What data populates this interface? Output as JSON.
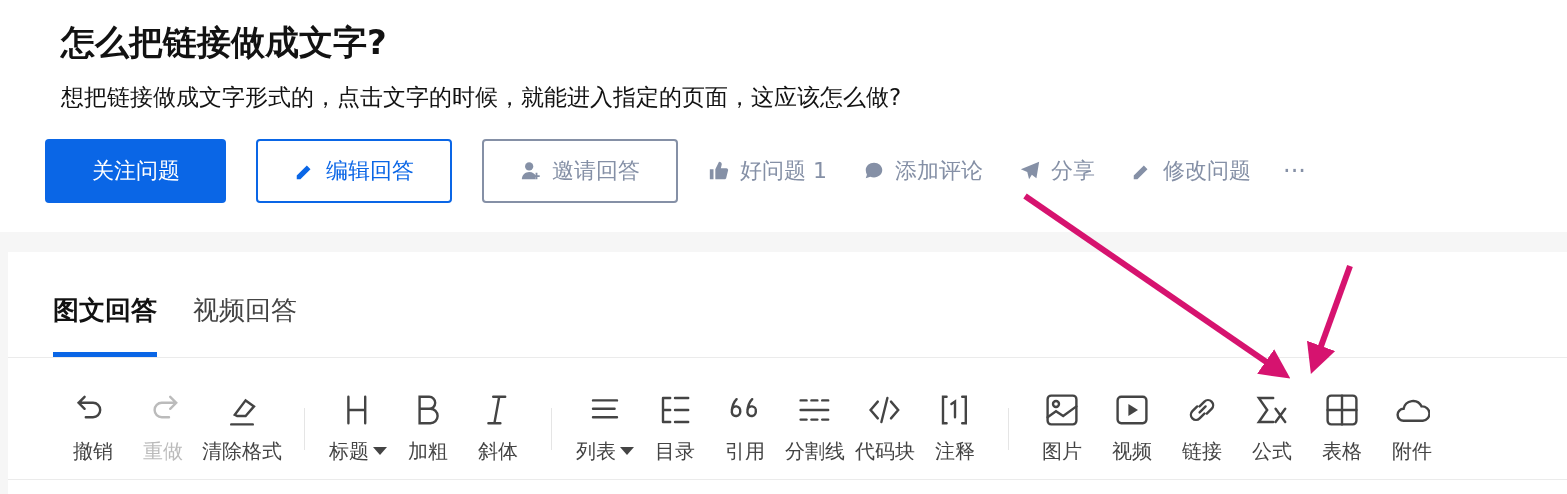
{
  "question": {
    "title": "怎么把链接做成文字?",
    "detail": "想把链接做成文字形式的，点击文字的时候，就能进入指定的页面，这应该怎么做?"
  },
  "actions": [
    {
      "kind": "primary",
      "label": "关注问题"
    },
    {
      "kind": "edit",
      "label": "编辑回答"
    },
    {
      "kind": "invite",
      "label": "邀请回答"
    },
    {
      "kind": "upvote",
      "label": "好问题 1"
    },
    {
      "kind": "comment",
      "label": "添加评论"
    },
    {
      "kind": "share",
      "label": "分享"
    },
    {
      "kind": "modify",
      "label": "修改问题"
    },
    {
      "kind": "more",
      "label": "···"
    }
  ],
  "tabs": [
    {
      "label": "图文回答",
      "selected": true
    },
    {
      "label": "视频回答",
      "selected": false
    }
  ],
  "toolbar": [
    [
      {
        "kind": "undo",
        "label": "撤销",
        "disabled": false
      },
      {
        "kind": "redo",
        "label": "重做",
        "disabled": true
      },
      {
        "kind": "eraser",
        "label": "清除格式",
        "disabled": false
      }
    ],
    [
      {
        "kind": "heading",
        "label": "标题",
        "dropdown": true,
        "disabled": false
      },
      {
        "kind": "bold",
        "label": "加粗",
        "disabled": false
      },
      {
        "kind": "italic",
        "label": "斜体",
        "disabled": false
      }
    ],
    [
      {
        "kind": "list",
        "label": "列表",
        "dropdown": true,
        "disabled": false
      },
      {
        "kind": "toc",
        "label": "目录",
        "disabled": false
      },
      {
        "kind": "quote",
        "label": "引用",
        "disabled": false
      },
      {
        "kind": "divider",
        "label": "分割线",
        "disabled": false
      },
      {
        "kind": "code",
        "label": "代码块",
        "disabled": false
      },
      {
        "kind": "note",
        "label": "注释",
        "disabled": false
      }
    ],
    [
      {
        "kind": "image",
        "label": "图片",
        "disabled": false
      },
      {
        "kind": "video",
        "label": "视频",
        "disabled": false
      },
      {
        "kind": "link",
        "label": "链接",
        "disabled": false
      },
      {
        "kind": "formula",
        "label": "公式",
        "disabled": false
      },
      {
        "kind": "table",
        "label": "表格",
        "disabled": false
      },
      {
        "kind": "attach",
        "label": "附件",
        "disabled": false
      }
    ]
  ]
}
